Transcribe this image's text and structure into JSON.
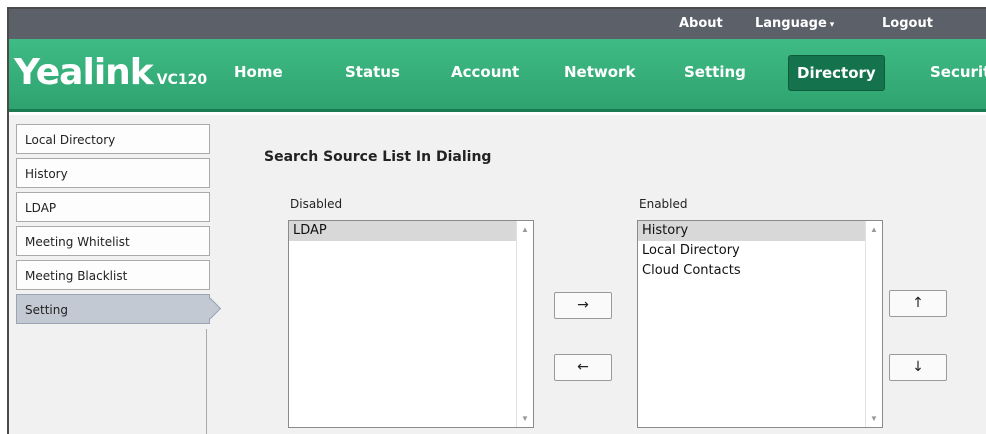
{
  "topbar": {
    "about": "About",
    "language": "Language",
    "language_caret": "▾",
    "logout": "Logout"
  },
  "brand": {
    "logo": "Yealink",
    "model": "VC120"
  },
  "nav": {
    "home": "Home",
    "status": "Status",
    "account": "Account",
    "network": "Network",
    "setting": "Setting",
    "directory": "Directory",
    "security": "Security",
    "active": "Directory"
  },
  "sidebar": {
    "items": [
      {
        "label": "Local Directory"
      },
      {
        "label": "History"
      },
      {
        "label": "LDAP"
      },
      {
        "label": "Meeting Whitelist"
      },
      {
        "label": "Meeting Blacklist"
      },
      {
        "label": "Setting"
      }
    ],
    "active": "Setting"
  },
  "main": {
    "heading": "Search Source List In Dialing",
    "disabled_label": "Disabled",
    "enabled_label": "Enabled",
    "disabled_items": [
      "LDAP"
    ],
    "enabled_items": [
      "History",
      "Local Directory",
      "Cloud Contacts"
    ],
    "disabled_selected": "LDAP",
    "enabled_selected": "History"
  },
  "buttons": {
    "move_right": "→",
    "move_left": "←",
    "move_up": "↑",
    "move_down": "↓"
  },
  "colors": {
    "nav_green": "#3fbb85",
    "active_tab": "#14734d",
    "topbar": "#5c6069",
    "sidebar_active": "#c2c9d3"
  }
}
